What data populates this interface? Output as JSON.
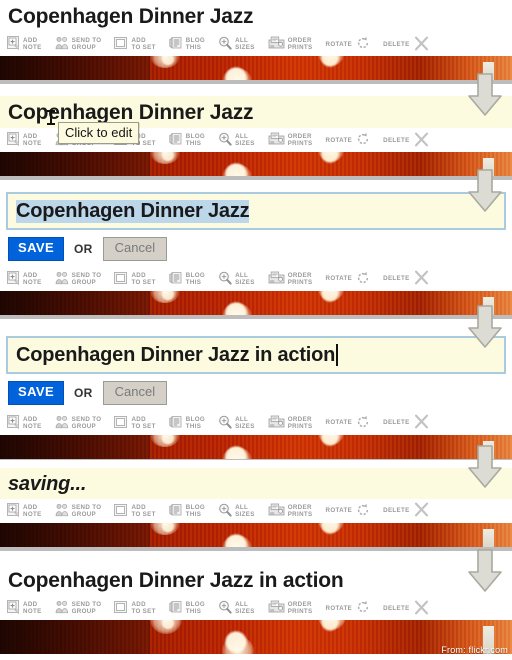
{
  "doc": {
    "watermark": "From: flickr.com"
  },
  "photo_title": {
    "original": "Copenhagen Dinner Jazz",
    "edited": "Copenhagen Dinner Jazz in action",
    "saving_label": "saving..."
  },
  "tooltip": {
    "text": "Click to edit"
  },
  "edit_form": {
    "save_label": "SAVE",
    "or_label": "OR",
    "cancel_label": "Cancel"
  },
  "toolbar": {
    "items": [
      {
        "icon": "add-note-icon",
        "line1": "ADD",
        "line2": "NOTE"
      },
      {
        "icon": "send-to-group-icon",
        "line1": "SEND TO",
        "line2": "GROUP"
      },
      {
        "icon": "add-to-set-icon",
        "line1": "ADD",
        "line2": "TO SET"
      },
      {
        "icon": "blog-this-icon",
        "line1": "BLOG",
        "line2": "THIS"
      },
      {
        "icon": "all-sizes-icon",
        "line1": "ALL",
        "line2": "SIZES"
      },
      {
        "icon": "order-prints-icon",
        "line1": "ORDER",
        "line2": "PRINTS"
      },
      {
        "icon": "rotate-icon",
        "line1": "ROTATE",
        "line2": ""
      },
      {
        "icon": "delete-icon",
        "line1": "DELETE",
        "line2": ""
      }
    ]
  },
  "colors": {
    "cream_background": "#fcfbdf",
    "save_blue": "#0063dc",
    "selection_blue": "#bcd6ea",
    "input_border": "#a9cadf",
    "arrow_gray": "#d5d5cf",
    "separator_gray": "#bdbdbd"
  },
  "steps": [
    {
      "id": "step-1-initial",
      "title_state": "original"
    },
    {
      "id": "step-2-hover",
      "title_state": "original"
    },
    {
      "id": "step-3-editing",
      "title_state": "original"
    },
    {
      "id": "step-4-typed",
      "title_state": "edited"
    },
    {
      "id": "step-5-saving",
      "title_state": "saving"
    },
    {
      "id": "step-6-saved",
      "title_state": "edited"
    }
  ]
}
